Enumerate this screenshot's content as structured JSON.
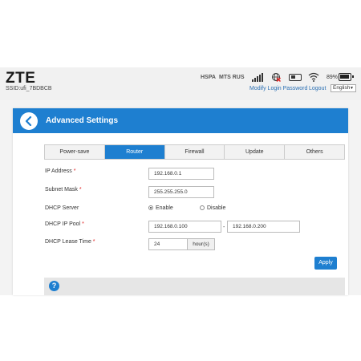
{
  "header": {
    "logo": "ZTE",
    "ssid": "SSID:ufi_7BDBCB",
    "network_type": "HSPA",
    "carrier": "MTS RUS",
    "battery": "89%",
    "links": {
      "modify_password": "Modify Login Password",
      "logout": "Logout"
    },
    "language": "English",
    "icons": [
      "signal-icon",
      "globe-icon",
      "sim-icon",
      "wifi-icon",
      "battery-icon"
    ]
  },
  "panel": {
    "title": "Advanced Settings",
    "tabs": [
      {
        "label": "Power-save",
        "active": false
      },
      {
        "label": "Router",
        "active": true
      },
      {
        "label": "Firewall",
        "active": false
      },
      {
        "label": "Update",
        "active": false
      },
      {
        "label": "Others",
        "active": false
      }
    ]
  },
  "form": {
    "ip_address": {
      "label": "IP Address",
      "required": "*",
      "value": "192.168.0.1"
    },
    "subnet_mask": {
      "label": "Subnet Mask",
      "required": "*",
      "value": "255.255.255.0"
    },
    "dhcp_server": {
      "label": "DHCP Server",
      "enable": "Enable",
      "disable": "Disable",
      "selected": "Enable"
    },
    "dhcp_pool": {
      "label": "DHCP IP Pool",
      "required": "*",
      "start": "192.168.0.100",
      "end": "192.168.0.200",
      "separator": "-"
    },
    "lease_time": {
      "label": "DHCP Lease Time",
      "required": "*",
      "value": "24",
      "unit": "hour(s)"
    },
    "apply": "Apply"
  },
  "help": {
    "icon": "?"
  },
  "colors": {
    "accent": "#1e7fd0",
    "required": "#e02020",
    "link": "#2a6fb3"
  }
}
